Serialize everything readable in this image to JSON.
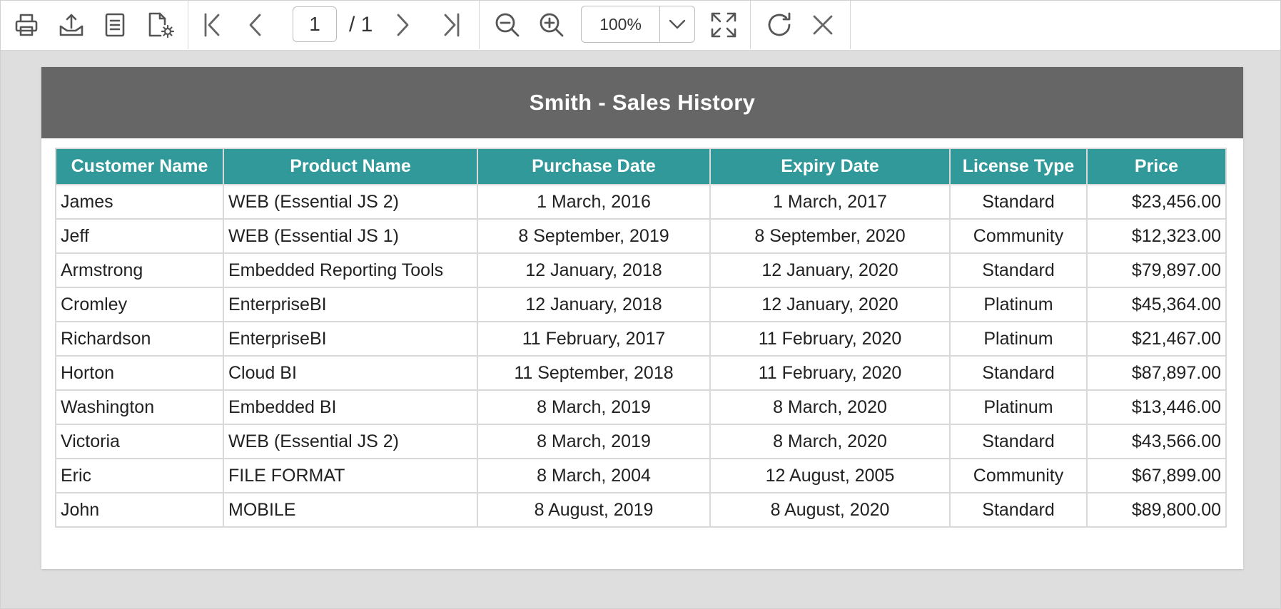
{
  "toolbar": {
    "page": {
      "current": "1",
      "total": "/ 1"
    },
    "zoom": {
      "value": "100%"
    },
    "icons": [
      "print-icon",
      "export-icon",
      "parameters-icon",
      "page-setup-icon",
      "first-page-icon",
      "previous-page-icon",
      "next-page-icon",
      "last-page-icon",
      "zoom-out-icon",
      "zoom-in-icon",
      "chevron-down-icon",
      "fit-page-icon",
      "refresh-icon",
      "close-icon"
    ]
  },
  "report": {
    "title": "Smith - Sales History",
    "header_color": "#666666",
    "table_header_color": "#319999",
    "columns": [
      "Customer Name",
      "Product Name",
      "Purchase Date",
      "Expiry Date",
      "License Type",
      "Price"
    ],
    "rows": [
      [
        "James",
        "WEB (Essential JS 2)",
        "1 March, 2016",
        "1 March, 2017",
        "Standard",
        "$23,456.00"
      ],
      [
        "Jeff",
        "WEB (Essential JS 1)",
        "8 September, 2019",
        "8 September, 2020",
        "Community",
        "$12,323.00"
      ],
      [
        "Armstrong",
        "Embedded Reporting Tools",
        "12 January, 2018",
        "12 January, 2020",
        "Standard",
        "$79,897.00"
      ],
      [
        "Cromley",
        "EnterpriseBI",
        "12 January, 2018",
        "12 January, 2020",
        "Platinum",
        "$45,364.00"
      ],
      [
        "Richardson",
        "EnterpriseBI",
        "11 February, 2017",
        "11 February, 2020",
        "Platinum",
        "$21,467.00"
      ],
      [
        "Horton",
        "Cloud BI",
        "11 September, 2018",
        "11 February, 2020",
        "Standard",
        "$87,897.00"
      ],
      [
        "Washington",
        "Embedded BI",
        "8 March, 2019",
        "8 March, 2020",
        "Platinum",
        "$13,446.00"
      ],
      [
        "Victoria",
        "WEB (Essential JS 2)",
        "8 March, 2019",
        "8 March, 2020",
        "Standard",
        "$43,566.00"
      ],
      [
        "Eric",
        "FILE FORMAT",
        "8 March, 2004",
        "12 August, 2005",
        "Community",
        "$67,899.00"
      ],
      [
        "John",
        "MOBILE",
        "8 August, 2019",
        "8 August, 2020",
        "Standard",
        "$89,800.00"
      ]
    ]
  }
}
